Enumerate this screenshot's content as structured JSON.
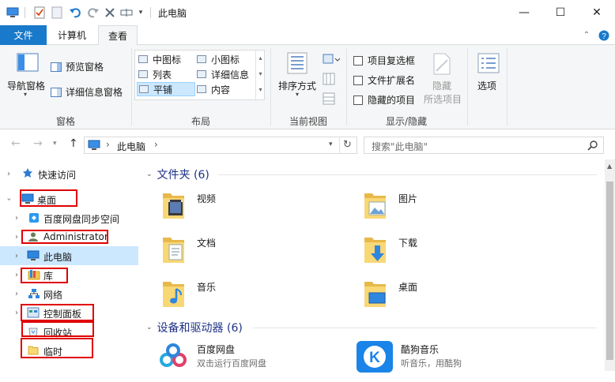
{
  "window": {
    "title": "此电脑",
    "minimize": "—",
    "maximize": "☐",
    "close": "✕",
    "help": "?",
    "expand_ribbon": "⌃"
  },
  "tabs": [
    {
      "label": "文件"
    },
    {
      "label": "计算机"
    },
    {
      "label": "查看"
    }
  ],
  "ribbon": {
    "pane": {
      "nav_pane": "导航窗格",
      "preview_pane": "预览窗格",
      "details_pane": "详细信息窗格",
      "group_label": "窗格"
    },
    "layout": {
      "items": [
        "中图标",
        "小图标",
        "列表",
        "详细信息",
        "平铺",
        "内容"
      ],
      "selected": "平铺",
      "group_label": "布局"
    },
    "current_view": {
      "sort_by": "排序方式",
      "group_label": "当前视图"
    },
    "show_hide": {
      "item_checkboxes": "项目复选框",
      "file_extensions": "文件扩展名",
      "hidden_items": "隐藏的项目",
      "hide": "隐藏",
      "selected_items": "所选项目",
      "group_label": "显示/隐藏"
    },
    "options": {
      "label": "选项"
    }
  },
  "address": {
    "path": "此电脑",
    "separator": "›",
    "search_placeholder": "搜索\"此电脑\""
  },
  "nav": {
    "items": [
      {
        "label": "快速访问",
        "icon": "star-icon"
      },
      {
        "label": "桌面",
        "icon": "desktop-icon"
      },
      {
        "label": "百度网盘同步空间",
        "icon": "baidu-sync-icon"
      },
      {
        "label": "Administrator",
        "icon": "user-icon"
      },
      {
        "label": "此电脑",
        "icon": "computer-icon"
      },
      {
        "label": "库",
        "icon": "library-icon"
      },
      {
        "label": "网络",
        "icon": "network-icon"
      },
      {
        "label": "控制面板",
        "icon": "control-panel-icon"
      },
      {
        "label": "回收站",
        "icon": "recycle-bin-icon"
      },
      {
        "label": "临时",
        "icon": "folder-icon"
      }
    ]
  },
  "content": {
    "folders_header": "文件夹 (6)",
    "folders": [
      {
        "label": "视频",
        "icon": "video-folder-icon"
      },
      {
        "label": "图片",
        "icon": "pictures-folder-icon"
      },
      {
        "label": "文档",
        "icon": "documents-folder-icon"
      },
      {
        "label": "下载",
        "icon": "downloads-folder-icon"
      },
      {
        "label": "音乐",
        "icon": "music-folder-icon"
      },
      {
        "label": "桌面",
        "icon": "desktop-folder-icon"
      }
    ],
    "devices_header": "设备和驱动器 (6)",
    "devices": [
      {
        "label": "百度网盘",
        "sub": "双击运行百度网盘",
        "icon": "baidu-netdisk-icon"
      },
      {
        "label": "酷狗音乐",
        "sub": "听音乐，用酷狗",
        "icon": "kugou-icon"
      }
    ]
  },
  "colors": {
    "accent": "#1979ca",
    "selection": "#cce8ff",
    "annotation": "#e00000",
    "header_text": "#1e3287"
  }
}
